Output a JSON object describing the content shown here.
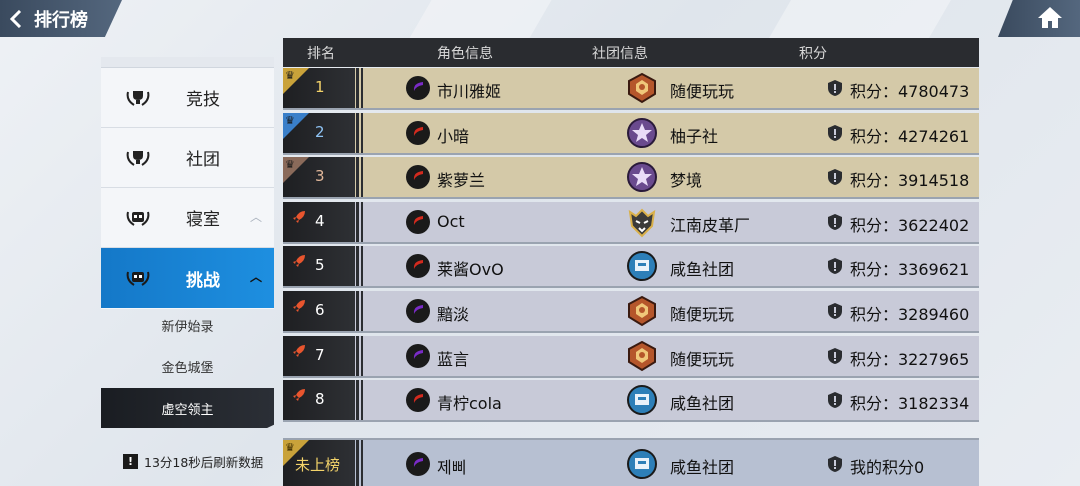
{
  "header": {
    "title": "排行榜",
    "back_icon": "chevron-left-icon",
    "home_icon": "home-icon"
  },
  "menu": {
    "items": [
      {
        "label": "竞技",
        "icon": "laurel-trophy-icon"
      },
      {
        "label": "社团",
        "icon": "laurel-trophy-icon"
      },
      {
        "label": "寝室",
        "icon": "laurel-building-icon",
        "chevron": "︿"
      },
      {
        "label": "挑战",
        "icon": "laurel-building-icon",
        "chevron": "︿",
        "active": true
      }
    ],
    "submenu": [
      {
        "label": "新伊始录"
      },
      {
        "label": "金色城堡"
      },
      {
        "label": "虚空领主",
        "selected": true
      }
    ],
    "refresh_note": "13分18秒后刷新数据"
  },
  "table": {
    "columns": [
      "排名",
      "角色信息",
      "社团信息",
      "积分"
    ],
    "rows": [
      {
        "rank": "1",
        "name": "市川雅姬",
        "club": "随便玩玩",
        "score": "积分：4780473",
        "tier": "gold",
        "corner": "#c9a23a",
        "char_color": "#7a2bc7",
        "club_emblem": "bronze"
      },
      {
        "rank": "2",
        "name": "小暗",
        "club": "柚子社",
        "score": "积分：4274261",
        "tier": "gold",
        "corner": "#3a7fc9",
        "char_color": "#d42a1e",
        "club_emblem": "purple-star"
      },
      {
        "rank": "3",
        "name": "紫萝兰",
        "club": "梦境",
        "score": "积分：3914518",
        "tier": "gold",
        "corner": "#8a6a5a",
        "char_color": "#d42a1e",
        "club_emblem": "purple-star"
      },
      {
        "rank": "4",
        "name": "Oct",
        "club": "江南皮革厂",
        "score": "积分：3622402",
        "tier": "norm",
        "char_color": "#d42a1e",
        "club_emblem": "wolf"
      },
      {
        "rank": "5",
        "name": "莱酱OvO",
        "club": "咸鱼社团",
        "score": "积分：3369621",
        "tier": "norm",
        "char_color": "#d42a1e",
        "club_emblem": "blue-castle"
      },
      {
        "rank": "6",
        "name": "黯淡",
        "club": "随便玩玩",
        "score": "积分：3289460",
        "tier": "norm",
        "char_color": "#7a2bc7",
        "club_emblem": "bronze"
      },
      {
        "rank": "7",
        "name": "蓝言",
        "club": "随便玩玩",
        "score": "积分：3227965",
        "tier": "norm",
        "char_color": "#7a2bc7",
        "club_emblem": "bronze"
      },
      {
        "rank": "8",
        "name": "青柠cola",
        "club": "咸鱼社团",
        "score": "积分：3182334",
        "tier": "norm",
        "char_color": "#d42a1e",
        "club_emblem": "blue-castle"
      }
    ],
    "mine": {
      "rank": "未上榜",
      "name": "제삐",
      "club": "咸鱼社团",
      "score": "我的积分0",
      "char_color": "#7a2bc7",
      "club_emblem": "blue-castle"
    }
  }
}
